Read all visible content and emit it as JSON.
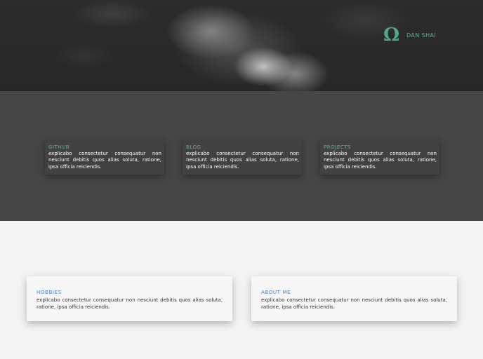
{
  "header": {
    "brand": {
      "logo_icon": "omega-icon",
      "logo_glyph": "Ω",
      "name": "DAN SHAI",
      "color": "#5ab393"
    }
  },
  "dark_section": {
    "cards": [
      {
        "title": "GITHUB",
        "text": "explicabo consectetur consequatur non nesciunt debitis quos alias soluta, ratione, ipsa officia reiciendis."
      },
      {
        "title": "BLOG",
        "text": "explicabo consectetur consequatur non nesciunt debitis quos alias soluta, ratione, ipsa officia reiciendis."
      },
      {
        "title": "PROJECTS",
        "text": "explicabo consectetur consequatur non nesciunt debitis quos alias soluta, ratione, ipsa officia reiciendis."
      }
    ]
  },
  "light_section": {
    "cards": [
      {
        "title": "HOBBIES",
        "text": "explicabo consectetur consequatur non nesciunt debitis quos alias soluta, ratione, ipsa officia reiciendis."
      },
      {
        "title": "ABOUT ME",
        "text": "explicabo consectetur consequatur non nesciunt debitis quos alias soluta, ratione, ipsa officia reiciendis."
      }
    ]
  },
  "colors": {
    "accent_green": "#5ab393",
    "accent_blue": "#4a83c8",
    "dark_band": "#464646",
    "light_bg": "#f3f3f3"
  }
}
